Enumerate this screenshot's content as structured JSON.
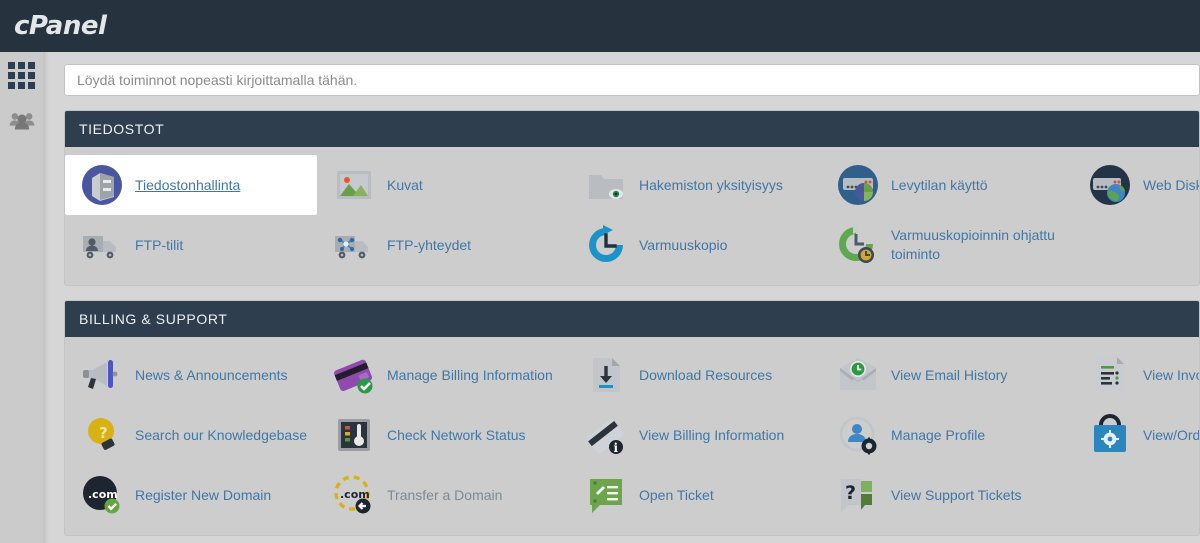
{
  "brand": {
    "name": "cPanel"
  },
  "sidebar": {
    "items": [
      {
        "name": "apps-grid-icon",
        "label": "Apps"
      },
      {
        "name": "user-manager-icon",
        "label": "User Manager"
      }
    ]
  },
  "search": {
    "placeholder": "Löydä toiminnot nopeasti kirjoittamalla tähän.",
    "value": ""
  },
  "sections": [
    {
      "title": "TIEDOSTOT",
      "items": [
        {
          "label": "Tiedostonhallinta",
          "icon": "file-manager-icon",
          "selected": true,
          "muted": false
        },
        {
          "label": "Kuvat",
          "icon": "images-icon",
          "selected": false,
          "muted": false
        },
        {
          "label": "Hakemiston yksityisyys",
          "icon": "directory-privacy-icon",
          "selected": false,
          "muted": false
        },
        {
          "label": "Levytilan käyttö",
          "icon": "disk-usage-icon",
          "selected": false,
          "muted": false
        },
        {
          "label": "Web Disk",
          "icon": "web-disk-icon",
          "selected": false,
          "muted": false
        },
        {
          "label": "FTP-tilit",
          "icon": "ftp-accounts-icon",
          "selected": false,
          "muted": false
        },
        {
          "label": "FTP-yhteydet",
          "icon": "ftp-connections-icon",
          "selected": false,
          "muted": false
        },
        {
          "label": "Varmuuskopio",
          "icon": "backup-icon",
          "selected": false,
          "muted": false
        },
        {
          "label": "Varmuuskopioinnin ohjattu toiminto",
          "icon": "backup-wizard-icon",
          "selected": false,
          "muted": false
        }
      ]
    },
    {
      "title": "BILLING & SUPPORT",
      "items": [
        {
          "label": "News & Announcements",
          "icon": "megaphone-icon",
          "selected": false,
          "muted": false
        },
        {
          "label": "Manage Billing Information",
          "icon": "credit-card-check-icon",
          "selected": false,
          "muted": false
        },
        {
          "label": "Download Resources",
          "icon": "download-file-icon",
          "selected": false,
          "muted": false
        },
        {
          "label": "View Email History",
          "icon": "email-history-icon",
          "selected": false,
          "muted": false
        },
        {
          "label": "View Invoices",
          "icon": "invoice-icon",
          "selected": false,
          "muted": false
        },
        {
          "label": "Search our Knowledgebase",
          "icon": "lightbulb-question-icon",
          "selected": false,
          "muted": false
        },
        {
          "label": "Check Network Status",
          "icon": "network-status-icon",
          "selected": false,
          "muted": false
        },
        {
          "label": "View Billing Information",
          "icon": "credit-card-info-icon",
          "selected": false,
          "muted": false
        },
        {
          "label": "Manage Profile",
          "icon": "profile-gear-icon",
          "selected": false,
          "muted": false
        },
        {
          "label": "View/Order Upgrades",
          "icon": "shopping-bag-icon",
          "selected": false,
          "muted": false
        },
        {
          "label": "Register New Domain",
          "icon": "register-domain-icon",
          "selected": false,
          "muted": false
        },
        {
          "label": "Transfer a Domain",
          "icon": "transfer-domain-icon",
          "selected": false,
          "muted": true
        },
        {
          "label": "Open Ticket",
          "icon": "open-ticket-icon",
          "selected": false,
          "muted": false
        },
        {
          "label": "View Support Tickets",
          "icon": "support-tickets-icon",
          "selected": false,
          "muted": false
        }
      ]
    }
  ],
  "colors": {
    "topbar": "#26333f",
    "panel_header": "#2f3e4e",
    "panel_body": "#cdcdcd",
    "link": "#4177a6",
    "page_background": "#d6d6d6"
  }
}
